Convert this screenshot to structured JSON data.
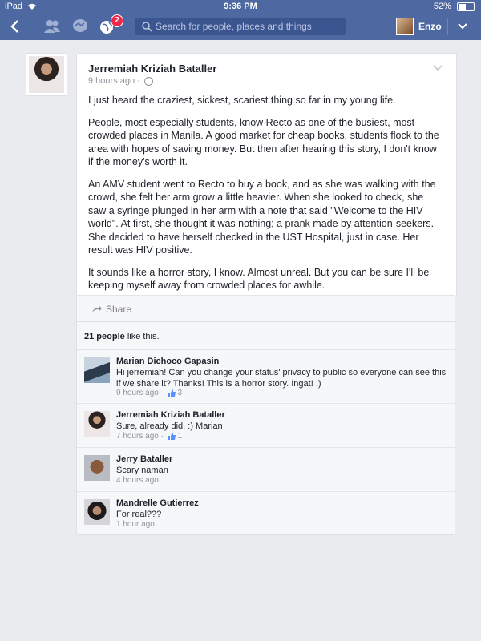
{
  "status_bar": {
    "device": "iPad",
    "time": "9:36 PM",
    "battery": "52%",
    "battery_level": 0.52
  },
  "nav": {
    "notification_count": "2",
    "search_placeholder": "Search for people, places and things",
    "user_name": "Enzo"
  },
  "post": {
    "author": "Jerremiah Kriziah Bataller",
    "time": "9 hours ago",
    "paragraphs": [
      "I just heard the craziest, sickest, scariest thing so far in my young life.",
      "People, most especially students, know Recto as one of the busiest, most crowded places in Manila. A good market for cheap books, students flock to the area with hopes of saving money. But then after hearing this story, I don't know if the money's worth it.",
      "An AMV student went to Recto to buy a book, and as she was walking with the crowd, she felt her arm grow a little heavier. When she looked to check, she saw a syringe plunged in her arm with a note that said \"Welcome to the HIV world\". At first, she thought it was nothing; a prank made by attention-seekers. She decided to have herself checked in the UST Hospital, just in case. Her result was HIV positive.",
      "It sounds like a horror story, I know. Almost unreal. But you can be sure I'll be keeping myself away from crowded places for awhile."
    ],
    "share_label": "Share"
  },
  "likes": {
    "count": "21 people",
    "suffix": "like this."
  },
  "comments": [
    {
      "name": "Marian Dichoco Gapasin",
      "text": "Hi jerremiah! Can you change your status' privacy to public so everyone can see this if we share it? Thanks! This is a horror story. Ingat! :)",
      "time": "9 hours ago",
      "likes": "3"
    },
    {
      "name": "Jerremiah Kriziah Bataller",
      "text": "Sure, already did. :) Marian",
      "time": "7 hours ago",
      "likes": "1"
    },
    {
      "name": "Jerry Bataller",
      "text": "Scary naman",
      "time": "4 hours ago",
      "likes": ""
    },
    {
      "name": "Mandrelle Gutierrez",
      "text": "For real???",
      "time": "1 hour ago",
      "likes": ""
    }
  ],
  "colors": {
    "nav_blue": "#4e69a2",
    "badge_red": "#f0284a",
    "text": "#1d2129",
    "meta": "#90949c"
  }
}
